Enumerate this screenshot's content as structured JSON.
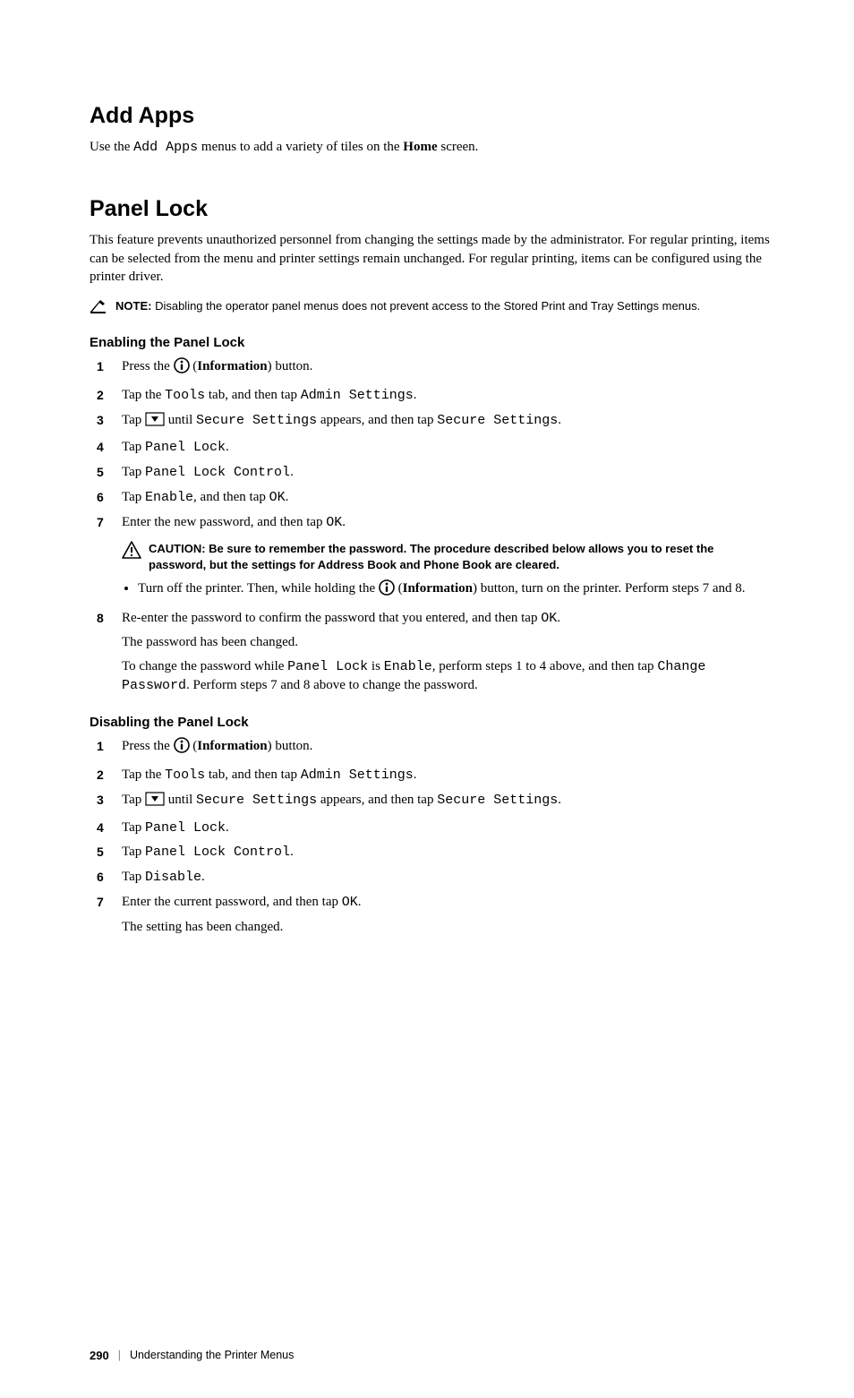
{
  "addApps": {
    "heading": "Add Apps",
    "p1a": "Use the ",
    "p1_mono": "Add Apps",
    "p1b": " menus to add a variety of tiles on the ",
    "p1_bold": "Home",
    "p1c": " screen."
  },
  "panelLock": {
    "heading": "Panel Lock",
    "intro": "This feature prevents unauthorized personnel from changing the settings made by the administrator. For regular printing, items can be selected from the menu and printer settings remain unchanged. For regular printing, items can be configured using the printer driver.",
    "note_label": "NOTE:",
    "note_text": " Disabling the operator panel menus does not prevent access to the Stored Print and Tray Settings menus."
  },
  "enable": {
    "heading": "Enabling the Panel Lock",
    "steps": {
      "s1a": "Press the ",
      "s1b": " (",
      "s1c": "Information",
      "s1d": ") button.",
      "s2a": "Tap the ",
      "s2_mono1": "Tools",
      "s2b": " tab, and then tap ",
      "s2_mono2": "Admin Settings",
      "s2c": ".",
      "s3a": "Tap ",
      "s3b": " until ",
      "s3_mono1": "Secure Settings",
      "s3c": " appears, and then tap ",
      "s3_mono2": "Secure Settings",
      "s3d": ".",
      "s4a": "Tap ",
      "s4_mono": "Panel Lock",
      "s4b": ".",
      "s5a": "Tap ",
      "s5_mono": "Panel Lock Control",
      "s5b": ".",
      "s6a": "Tap ",
      "s6_mono1": "Enable",
      "s6b": ", and then tap ",
      "s6_mono2": "OK",
      "s6c": ".",
      "s7a": "Enter the new password, and then tap ",
      "s7_mono": "OK",
      "s7b": ".",
      "caution_label": "CAUTION:",
      "caution_text": " Be sure to remember the password. The procedure described below allows you to reset the password, but the settings for Address Book and Phone Book are cleared.",
      "bullet_a": "Turn off the printer. Then, while holding the ",
      "bullet_b": " (",
      "bullet_c": "Information",
      "bullet_d": ") button, turn on the printer. Perform steps 7 and 8.",
      "s8a": "Re-enter the password to confirm the password that you entered, and then tap ",
      "s8_mono": "OK",
      "s8b": ".",
      "pw_changed": "The password has been changed.",
      "change_a": "To change the password while ",
      "change_mono1": "Panel Lock",
      "change_b": " is ",
      "change_mono2": "Enable",
      "change_c": ", perform steps 1 to 4 above, and then tap ",
      "change_mono3": "Change Password",
      "change_d": ". Perform steps 7 and 8 above to change the password."
    }
  },
  "disable": {
    "heading": "Disabling the Panel Lock",
    "steps": {
      "s1a": "Press the ",
      "s1b": " (",
      "s1c": "Information",
      "s1d": ") button.",
      "s2a": "Tap the ",
      "s2_mono1": "Tools",
      "s2b": " tab, and then tap ",
      "s2_mono2": "Admin Settings",
      "s2c": ".",
      "s3a": "Tap ",
      "s3b": " until ",
      "s3_mono1": "Secure Settings",
      "s3c": " appears, and then tap ",
      "s3_mono2": "Secure Settings",
      "s3d": ".",
      "s4a": "Tap ",
      "s4_mono": "Panel Lock",
      "s4b": ".",
      "s5a": "Tap ",
      "s5_mono": "Panel Lock Control",
      "s5b": ".",
      "s6a": "Tap ",
      "s6_mono": "Disable",
      "s6b": ".",
      "s7a": "Enter the current password, and then tap ",
      "s7_mono": "OK",
      "s7b": ".",
      "changed": "The setting has been changed."
    }
  },
  "footer": {
    "page": "290",
    "title": "Understanding the Printer Menus"
  }
}
